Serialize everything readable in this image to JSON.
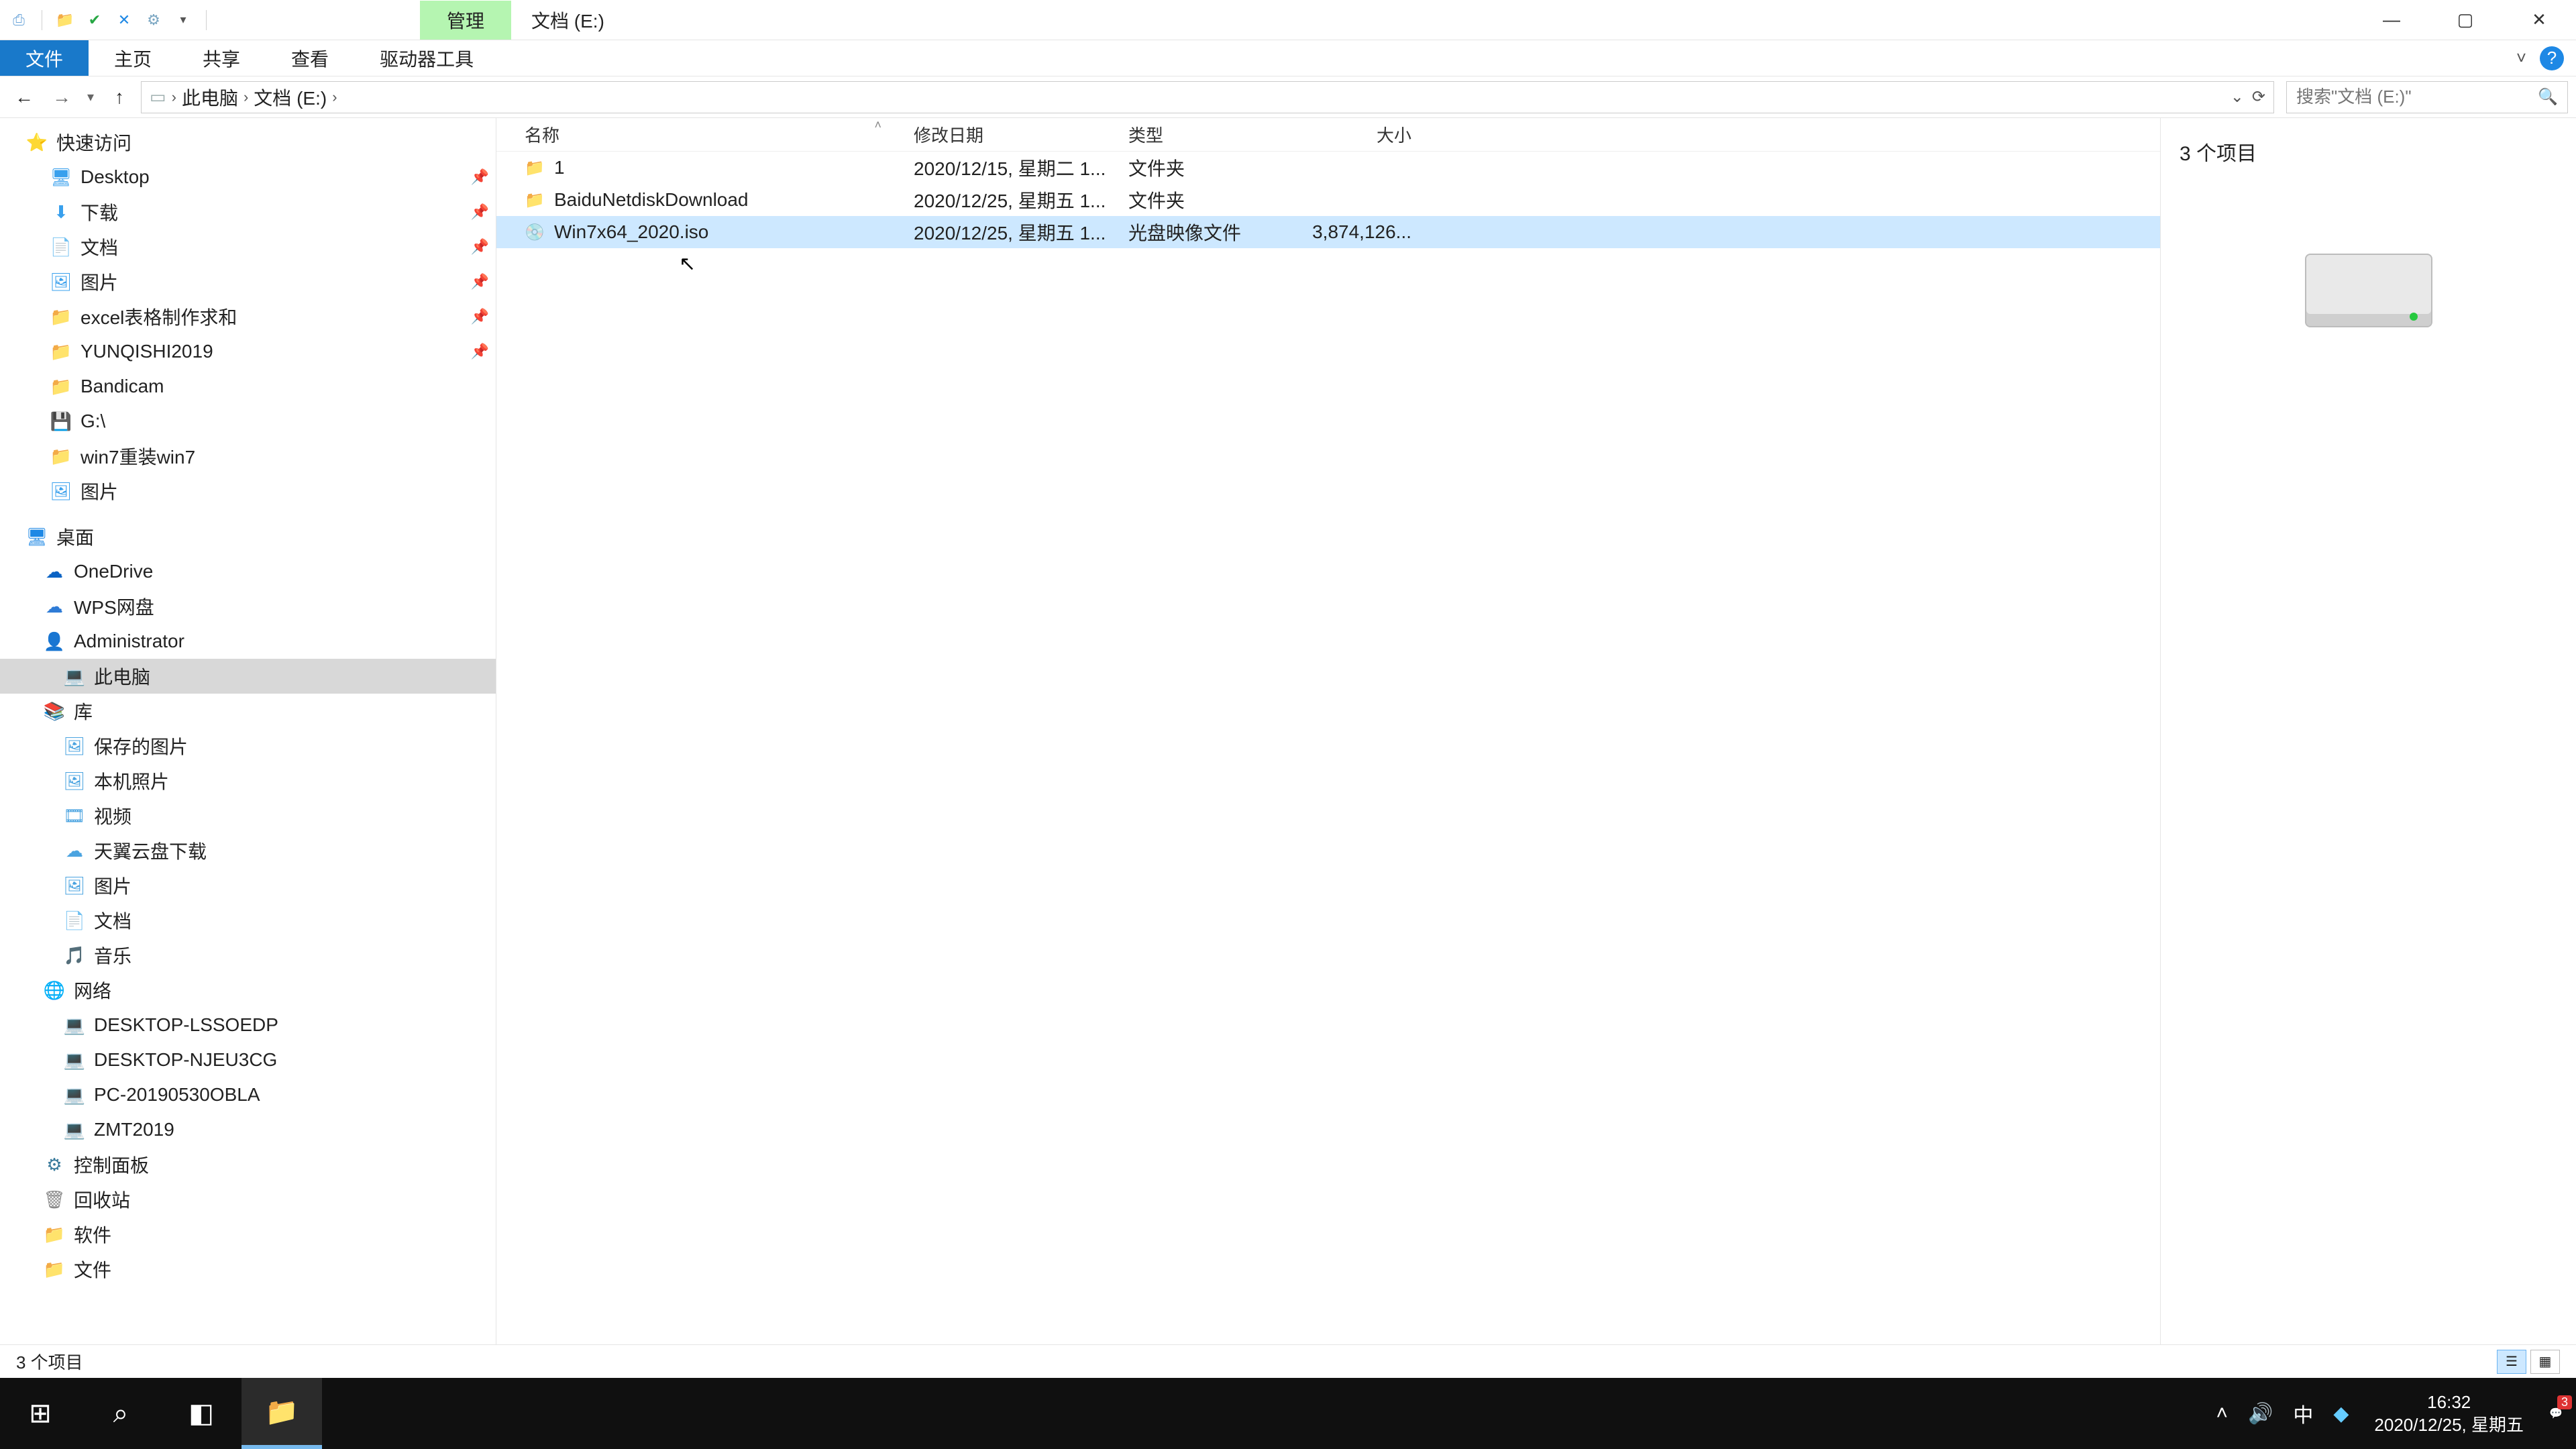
{
  "title": "文档 (E:)",
  "ribbon_context": "管理",
  "ribbon_tabs": {
    "file": "文件",
    "home": "主页",
    "share": "共享",
    "view": "查看",
    "drive": "驱动器工具"
  },
  "breadcrumb": [
    "此电脑",
    "文档 (E:)"
  ],
  "search_placeholder": "搜索\"文档 (E:)\"",
  "columns": {
    "name": "名称",
    "date": "修改日期",
    "type": "类型",
    "size": "大小"
  },
  "files": [
    {
      "icon": "folder",
      "name": "1",
      "date": "2020/12/15, 星期二 1...",
      "type": "文件夹",
      "size": ""
    },
    {
      "icon": "folder",
      "name": "BaiduNetdiskDownload",
      "date": "2020/12/25, 星期五 1...",
      "type": "文件夹",
      "size": ""
    },
    {
      "icon": "iso",
      "name": "Win7x64_2020.iso",
      "date": "2020/12/25, 星期五 1...",
      "type": "光盘映像文件",
      "size": "3,874,126...",
      "selected": true
    }
  ],
  "nav_groups": [
    {
      "items": [
        {
          "indent": 36,
          "ico": "⭐",
          "icocolor": "#f3b01b",
          "label": "快速访问"
        },
        {
          "indent": 72,
          "ico": "🖥",
          "icocolor": "#39a0ed",
          "label": "Desktop",
          "pin": true
        },
        {
          "indent": 72,
          "ico": "⬇",
          "icocolor": "#39a0ed",
          "label": "下载",
          "pin": true
        },
        {
          "indent": 72,
          "ico": "📄",
          "icocolor": "#39a0ed",
          "label": "文档",
          "pin": true
        },
        {
          "indent": 72,
          "ico": "🖼",
          "icocolor": "#39a0ed",
          "label": "图片",
          "pin": true
        },
        {
          "indent": 72,
          "ico": "📁",
          "icocolor": "#f5c869",
          "label": "excel表格制作求和",
          "pin": true
        },
        {
          "indent": 72,
          "ico": "📁",
          "icocolor": "#f5c869",
          "label": "YUNQISHI2019",
          "pin": true
        },
        {
          "indent": 72,
          "ico": "📁",
          "icocolor": "#f5c869",
          "label": "Bandicam"
        },
        {
          "indent": 72,
          "ico": "💾",
          "icocolor": "#999",
          "label": "G:\\"
        },
        {
          "indent": 72,
          "ico": "📁",
          "icocolor": "#f5c869",
          "label": "win7重装win7"
        },
        {
          "indent": 72,
          "ico": "🖼",
          "icocolor": "#39a0ed",
          "label": "图片"
        }
      ]
    },
    {
      "items": [
        {
          "indent": 36,
          "ico": "🖥",
          "icocolor": "#1e88e5",
          "label": "桌面"
        },
        {
          "indent": 62,
          "ico": "☁",
          "icocolor": "#0b63c4",
          "label": "OneDrive"
        },
        {
          "indent": 62,
          "ico": "☁",
          "icocolor": "#2e7bd6",
          "label": "WPS网盘"
        },
        {
          "indent": 62,
          "ico": "👤",
          "icocolor": "#d08c2f",
          "label": "Administrator"
        },
        {
          "indent": 92,
          "ico": "💻",
          "icocolor": "#1e88e5",
          "label": "此电脑",
          "selected": true
        },
        {
          "indent": 62,
          "ico": "📚",
          "icocolor": "#c99b3a",
          "label": "库"
        },
        {
          "indent": 92,
          "ico": "🖼",
          "icocolor": "#4aa3e0",
          "label": "保存的图片"
        },
        {
          "indent": 92,
          "ico": "🖼",
          "icocolor": "#4aa3e0",
          "label": "本机照片"
        },
        {
          "indent": 92,
          "ico": "🎞",
          "icocolor": "#4aa3e0",
          "label": "视频"
        },
        {
          "indent": 92,
          "ico": "☁",
          "icocolor": "#4aa3e0",
          "label": "天翼云盘下载"
        },
        {
          "indent": 92,
          "ico": "🖼",
          "icocolor": "#4aa3e0",
          "label": "图片"
        },
        {
          "indent": 92,
          "ico": "📄",
          "icocolor": "#4aa3e0",
          "label": "文档"
        },
        {
          "indent": 92,
          "ico": "🎵",
          "icocolor": "#4aa3e0",
          "label": "音乐"
        },
        {
          "indent": 62,
          "ico": "🌐",
          "icocolor": "#3a86c8",
          "label": "网络"
        },
        {
          "indent": 92,
          "ico": "💻",
          "icocolor": "#4aa3e0",
          "label": "DESKTOP-LSSOEDP"
        },
        {
          "indent": 92,
          "ico": "💻",
          "icocolor": "#4aa3e0",
          "label": "DESKTOP-NJEU3CG"
        },
        {
          "indent": 92,
          "ico": "💻",
          "icocolor": "#4aa3e0",
          "label": "PC-20190530OBLA"
        },
        {
          "indent": 92,
          "ico": "💻",
          "icocolor": "#4aa3e0",
          "label": "ZMT2019"
        },
        {
          "indent": 62,
          "ico": "⚙",
          "icocolor": "#3a7b9c",
          "label": "控制面板"
        },
        {
          "indent": 62,
          "ico": "🗑",
          "icocolor": "#888",
          "label": "回收站"
        },
        {
          "indent": 62,
          "ico": "📁",
          "icocolor": "#f5c869",
          "label": "软件"
        },
        {
          "indent": 62,
          "ico": "📁",
          "icocolor": "#f5c869",
          "label": "文件"
        }
      ]
    }
  ],
  "preview_header": "3 个项目",
  "status_text": "3 个项目",
  "taskbar": {
    "time": "16:32",
    "date": "2020/12/25, 星期五",
    "ime": "中",
    "ac_badge": "3"
  }
}
